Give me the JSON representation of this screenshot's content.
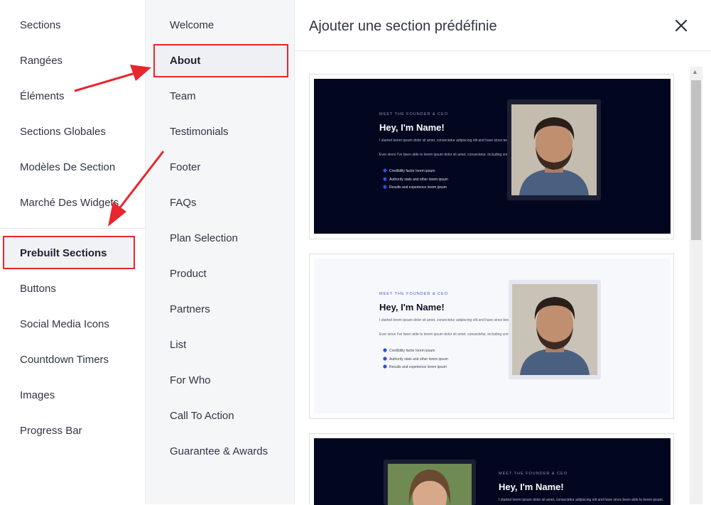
{
  "nav": {
    "items": [
      "Sections",
      "Rangées",
      "Éléments",
      "Sections Globales",
      "Modèles De Section",
      "Marché Des Widgets",
      "Prebuilt Sections",
      "Buttons",
      "Social Media Icons",
      "Countdown Timers",
      "Images",
      "Progress Bar"
    ]
  },
  "categories": {
    "items": [
      "Welcome",
      "About",
      "Team",
      "Testimonials",
      "Footer",
      "FAQs",
      "Plan Selection",
      "Product",
      "Partners",
      "List",
      "For Who",
      "Call To Action",
      "Guarantee & Awards"
    ]
  },
  "header": {
    "title": "Ajouter une section prédéfinie",
    "close_icon": "close-icon"
  },
  "previews": [
    {
      "eyebrow": "MEET THE FOUNDER & CEO",
      "heading": "Hey, I'm Name!",
      "para1": "I started lorem ipsum dolor sit amet, consectetur adipiscing elit and have since been able to lorem ipsum.",
      "para2": "Ever since I've been able to lorem ipsum dolor sit amet, consectetur, including some cool stuff like:",
      "bullets": [
        "Credibility factor lorem ipsum",
        "Authority stats and other lorem ipsum",
        "Results and experience lorem ipsum"
      ]
    },
    {
      "eyebrow": "MEET THE FOUNDER & CEO",
      "heading": "Hey, I'm Name!",
      "para1": "I started lorem ipsum dolor sit amet, consectetur adipiscing elit and have since been able to lorem ipsum.",
      "para2": "Ever since I've been able to lorem ipsum dolor sit amet, consectetur, including some cool stuff like:",
      "bullets": [
        "Credibility factor lorem ipsum",
        "Authority stats and other lorem ipsum",
        "Results and experience lorem ipsum"
      ]
    },
    {
      "eyebrow": "MEET THE FOUNDER & CEO",
      "heading": "Hey, I'm Name!",
      "para1": "I started lorem ipsum dolor sit amet, consectetur adipiscing elit and have since been able to lorem ipsum."
    }
  ],
  "colors": {
    "accent": "#e8262d",
    "dark_bg": "#03061f",
    "bullet": "#2f4fd8"
  }
}
